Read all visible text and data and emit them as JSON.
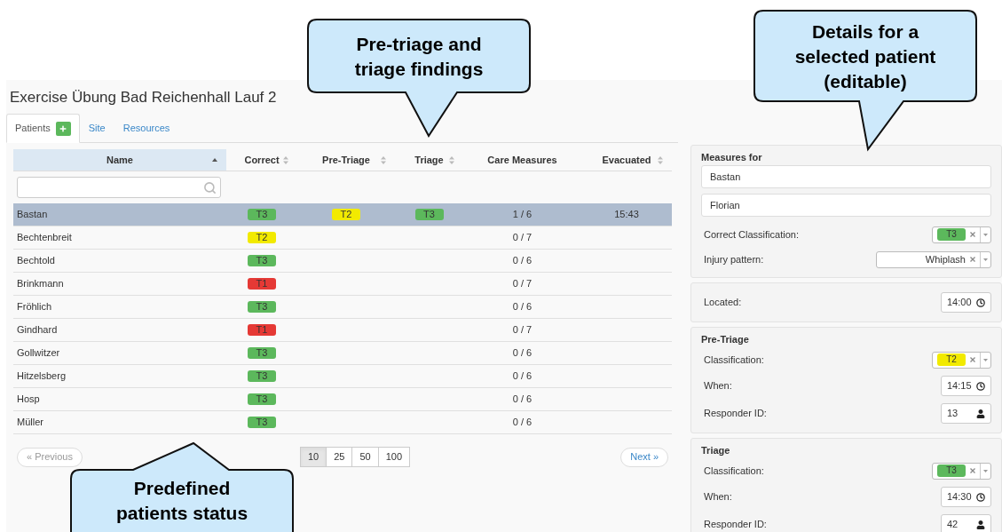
{
  "title": "Exercise Übung Bad Reichenhall Lauf 2",
  "tabs": [
    {
      "label": "Patients",
      "selected": true,
      "add_button": true
    },
    {
      "label": "Site",
      "selected": false
    },
    {
      "label": "Resources",
      "selected": false
    }
  ],
  "table": {
    "columns": [
      {
        "label": "Name",
        "sortable": true,
        "sorted": true
      },
      {
        "label": "Correct",
        "sortable": true,
        "sorted": false
      },
      {
        "label": "Pre-Triage",
        "sortable": true,
        "sorted": false
      },
      {
        "label": "Triage",
        "sortable": true,
        "sorted": false
      },
      {
        "label": "Care Measures",
        "sortable": false,
        "sorted": false
      },
      {
        "label": "Evacuated",
        "sortable": true,
        "sorted": false
      }
    ],
    "rows": [
      {
        "name": "Bastan",
        "selected": true,
        "correct": {
          "label": "T3",
          "color": "#5cb85c"
        },
        "pre_triage": {
          "label": "T2",
          "color": "#f2ea00"
        },
        "triage": {
          "label": "T3",
          "color": "#5cb85c"
        },
        "care": "1 / 6",
        "evacuated": "15:43"
      },
      {
        "name": "Bechtenbreit",
        "selected": false,
        "correct": {
          "label": "T2",
          "color": "#f2ea00"
        },
        "care": "0 / 7"
      },
      {
        "name": "Bechtold",
        "selected": false,
        "correct": {
          "label": "T3",
          "color": "#5cb85c"
        },
        "care": "0 / 6"
      },
      {
        "name": "Brinkmann",
        "selected": false,
        "correct": {
          "label": "T1",
          "color": "#e53935"
        },
        "care": "0 / 7"
      },
      {
        "name": "Fröhlich",
        "selected": false,
        "correct": {
          "label": "T3",
          "color": "#5cb85c"
        },
        "care": "0 / 6"
      },
      {
        "name": "Gindhard",
        "selected": false,
        "correct": {
          "label": "T1",
          "color": "#e53935"
        },
        "care": "0 / 7"
      },
      {
        "name": "Gollwitzer",
        "selected": false,
        "correct": {
          "label": "T3",
          "color": "#5cb85c"
        },
        "care": "0 / 6"
      },
      {
        "name": "Hitzelsberg",
        "selected": false,
        "correct": {
          "label": "T3",
          "color": "#5cb85c"
        },
        "care": "0 / 6"
      },
      {
        "name": "Hosp",
        "selected": false,
        "correct": {
          "label": "T3",
          "color": "#5cb85c"
        },
        "care": "0 / 6"
      },
      {
        "name": "Müller",
        "selected": false,
        "correct": {
          "label": "T3",
          "color": "#5cb85c"
        },
        "care": "0 / 6"
      }
    ]
  },
  "pagination": {
    "previous": "« Previous",
    "next": "Next »",
    "sizes": [
      {
        "label": "10",
        "selected": true
      },
      {
        "label": "25",
        "selected": false
      },
      {
        "label": "50",
        "selected": false
      },
      {
        "label": "100",
        "selected": false
      }
    ]
  },
  "details": [
    {
      "heading": "Measures for",
      "fields": [
        {
          "kind": "text",
          "value": "Bastan"
        },
        {
          "kind": "text",
          "value": "Florian"
        },
        {
          "kind": "tag",
          "label": "Correct Classification:",
          "value": "T3",
          "color": "#5cb85c"
        },
        {
          "kind": "select",
          "label": "Injury pattern:",
          "value": "Whiplash"
        }
      ]
    },
    {
      "fields": [
        {
          "kind": "time",
          "label": "Located:",
          "value": "14:00"
        }
      ]
    },
    {
      "heading": "Pre-Triage",
      "fields": [
        {
          "kind": "tag",
          "label": "Classification:",
          "value": "T2",
          "color": "#f2ea00"
        },
        {
          "kind": "time",
          "label": "When:",
          "value": "14:15"
        },
        {
          "kind": "user",
          "label": "Responder ID:",
          "value": "13"
        }
      ]
    },
    {
      "heading": "Triage",
      "fields": [
        {
          "kind": "tag",
          "label": "Classification:",
          "value": "T3",
          "color": "#5cb85c"
        },
        {
          "kind": "time",
          "label": "When:",
          "value": "14:30"
        },
        {
          "kind": "user",
          "label": "Responder ID:",
          "value": "42"
        }
      ]
    }
  ],
  "callouts": [
    {
      "text": "Pre-triage and triage findings"
    },
    {
      "text": "Details for a selected patient (editable)"
    },
    {
      "text": "Predefined patients status"
    }
  ]
}
